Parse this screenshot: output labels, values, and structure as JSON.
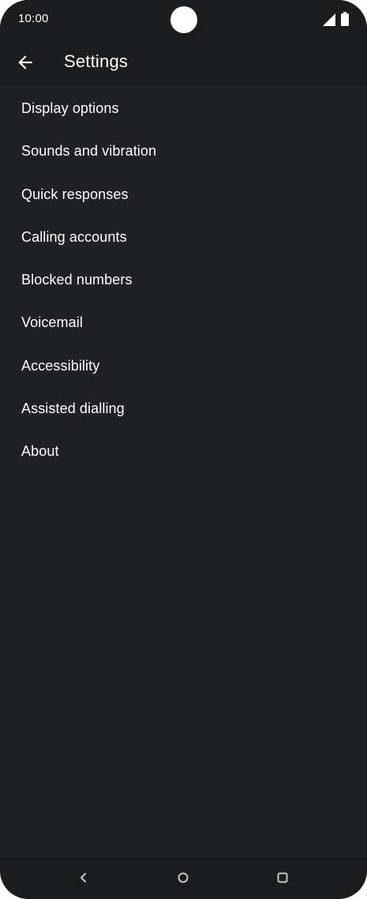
{
  "status_bar": {
    "time": "10:00",
    "signal_icon": "cellular-signal-icon",
    "battery_icon": "battery-full-icon"
  },
  "app_bar": {
    "back_icon": "back-arrow-icon",
    "title": "Settings"
  },
  "settings": {
    "items": [
      {
        "label": "Display options"
      },
      {
        "label": "Sounds and vibration"
      },
      {
        "label": "Quick responses"
      },
      {
        "label": "Calling accounts"
      },
      {
        "label": "Blocked numbers"
      },
      {
        "label": "Voicemail"
      },
      {
        "label": "Accessibility"
      },
      {
        "label": "Assisted dialling"
      },
      {
        "label": "About"
      }
    ]
  },
  "nav_bar": {
    "back_icon": "nav-back-icon",
    "home_icon": "nav-home-icon",
    "recents_icon": "nav-recents-icon"
  },
  "colors": {
    "background": "#202124",
    "bars": "#1b1c1e",
    "text": "#ffffff",
    "nav_icons": "#c4c7c5"
  }
}
